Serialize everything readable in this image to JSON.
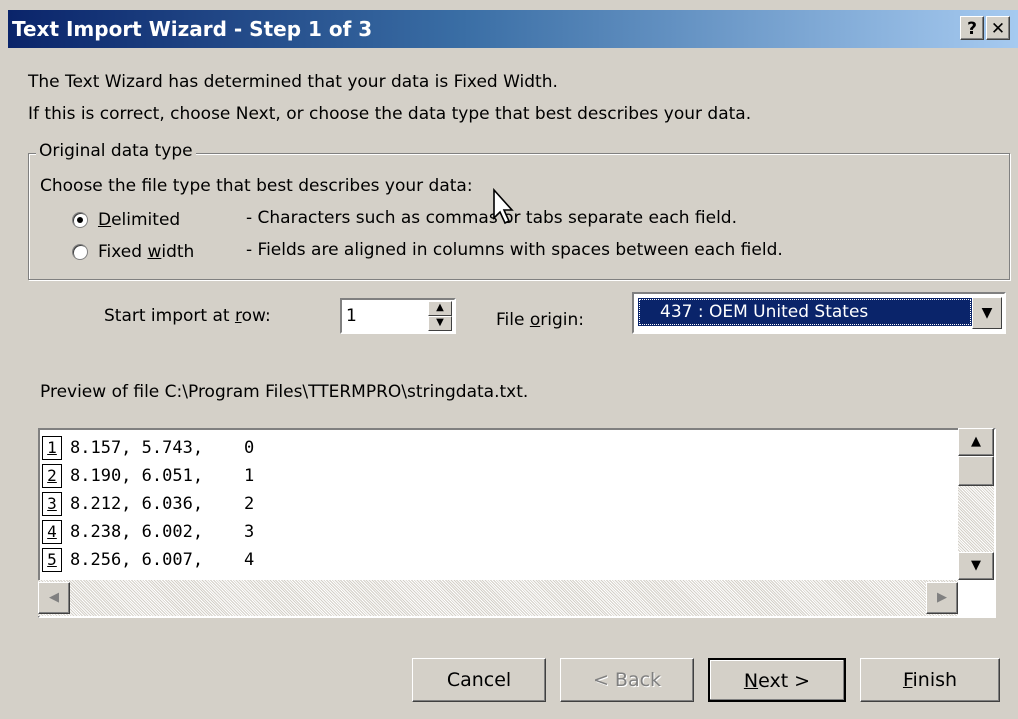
{
  "window": {
    "title": "Text Import Wizard - Step 1 of 3",
    "help_label": "?",
    "close_label": "✕"
  },
  "intro": {
    "line1": "The Text Wizard has determined that your data is Fixed Width.",
    "line2": "If this is correct, choose Next, or choose the data type that best describes your data."
  },
  "original_data_type": {
    "legend": "Original data type",
    "prompt": "Choose the file type that best describes your data:",
    "options": [
      {
        "label": "Delimited",
        "description": "- Characters such as commas or tabs separate each field.",
        "selected": true
      },
      {
        "label": "Fixed width",
        "description": "- Fields are aligned in columns with spaces between each field.",
        "selected": false
      }
    ]
  },
  "start_row": {
    "label": "Start import at row:",
    "value": "1"
  },
  "file_origin": {
    "label": "File origin:",
    "value": "437 : OEM United States"
  },
  "preview": {
    "label": "Preview of file C:\\Program Files\\TTERMPRO\\stringdata.txt.",
    "rows": [
      {
        "num": "1",
        "text": "8.157, 5.743,    0"
      },
      {
        "num": "2",
        "text": "8.190, 6.051,    1"
      },
      {
        "num": "3",
        "text": "8.212, 6.036,    2"
      },
      {
        "num": "4",
        "text": "8.238, 6.002,    3"
      },
      {
        "num": "5",
        "text": "8.256, 6.007,    4"
      }
    ]
  },
  "buttons": {
    "cancel": "Cancel",
    "back": "< Back",
    "next": "Next >",
    "finish": "Finish"
  },
  "icons": [
    "help-icon",
    "close-icon",
    "spin-up-icon",
    "spin-down-icon",
    "dropdown-arrow-icon",
    "scroll-up-icon",
    "scroll-down-icon",
    "scroll-left-icon",
    "scroll-right-icon",
    "mouse-cursor-icon"
  ]
}
